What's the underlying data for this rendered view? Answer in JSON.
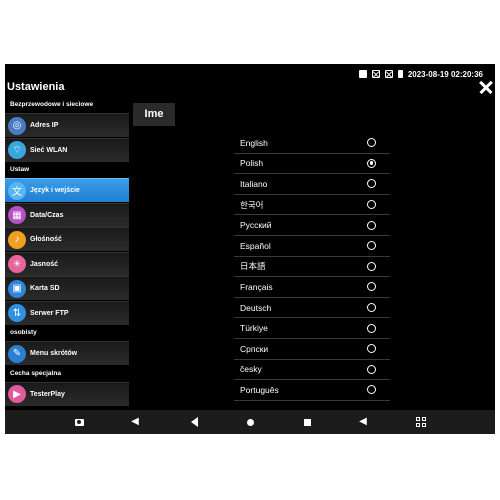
{
  "status": {
    "datetime": "2023-08-19 02:20:36"
  },
  "app": {
    "title": "Ustawienia"
  },
  "sidebar": {
    "sections": [
      {
        "header": "Bezprzewodowe i sieciowe",
        "items": [
          {
            "label": "Adres IP",
            "icon": "globe-icon",
            "color": "#4a7cc4",
            "glyph": "◎"
          },
          {
            "label": "Sieć WLAN",
            "icon": "wifi-icon",
            "color": "#3aa6e0",
            "glyph": "⌔"
          }
        ]
      },
      {
        "header": "Ustaw",
        "items": [
          {
            "label": "Język i wejście",
            "icon": "language-icon",
            "color": "#58b6f0",
            "glyph": "文",
            "active": true
          },
          {
            "label": "Data/Czas",
            "icon": "calendar-icon",
            "color": "#b84fc9",
            "glyph": "▦"
          },
          {
            "label": "Głośność",
            "icon": "volume-icon",
            "color": "#f0a020",
            "glyph": "♪"
          },
          {
            "label": "Jasność",
            "icon": "brightness-icon",
            "color": "#e8649a",
            "glyph": "☀"
          },
          {
            "label": "Karta SD",
            "icon": "sd-card-icon",
            "color": "#2f86d8",
            "glyph": "▣"
          },
          {
            "label": "Serwer FTP",
            "icon": "ftp-icon",
            "color": "#2f8fe0",
            "glyph": "⇅"
          }
        ]
      },
      {
        "header": "osobisty",
        "items": [
          {
            "label": "Menu skrótów",
            "icon": "shortcut-menu-icon",
            "color": "#2a7fd0",
            "glyph": "✎"
          }
        ]
      },
      {
        "header": "Cecha specjalna",
        "items": [
          {
            "label": "TesterPlay",
            "icon": "testerplay-icon",
            "color": "#e05aa0",
            "glyph": "▶"
          }
        ]
      }
    ]
  },
  "main": {
    "title": "Ime",
    "languages": [
      {
        "name": "English",
        "selected": false
      },
      {
        "name": "Polish",
        "selected": true
      },
      {
        "name": "Italiano",
        "selected": false
      },
      {
        "name": "한국어",
        "selected": false
      },
      {
        "name": "Русский",
        "selected": false
      },
      {
        "name": "Español",
        "selected": false
      },
      {
        "name": "日本語",
        "selected": false
      },
      {
        "name": "Français",
        "selected": false
      },
      {
        "name": "Deutsch",
        "selected": false
      },
      {
        "name": "Türkiye",
        "selected": false
      },
      {
        "name": "Српски",
        "selected": false
      },
      {
        "name": "česky",
        "selected": false
      },
      {
        "name": "Português",
        "selected": false
      }
    ]
  },
  "navbar": {
    "buttons": [
      "camera-icon",
      "volume-down-icon",
      "back-icon",
      "home-icon",
      "recents-icon",
      "volume-up-icon",
      "apps-grid-icon"
    ]
  }
}
